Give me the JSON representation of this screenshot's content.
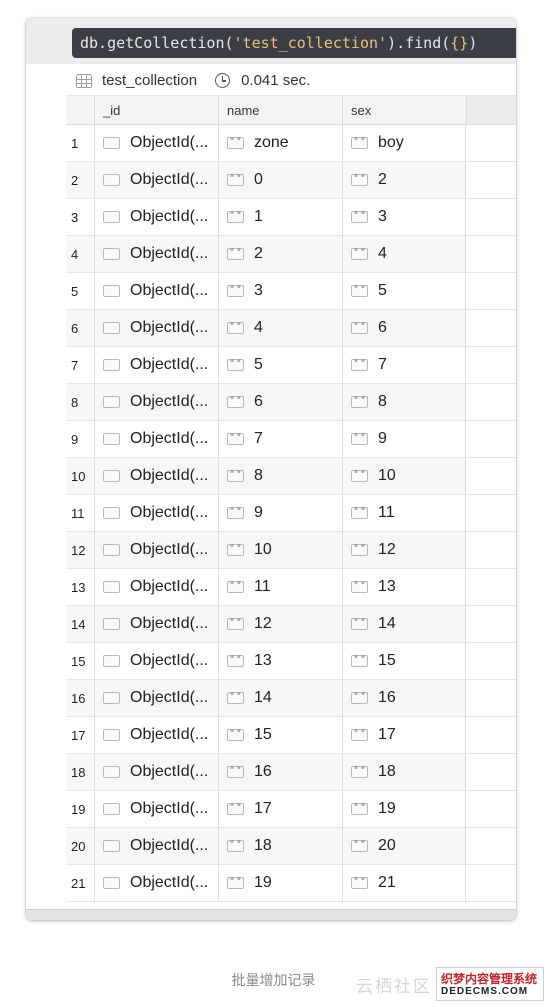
{
  "query": {
    "prefix": "db.getCollection(",
    "collection_arg": "'test_collection'",
    "suffix": ").find(",
    "braces": "{}",
    "close": ")"
  },
  "info": {
    "collection_name": "test_collection",
    "elapsed": "0.041 sec.",
    "table_icon": "table-icon",
    "clock_icon": "clock-icon"
  },
  "columns": [
    "_id",
    "name",
    "sex"
  ],
  "rows": [
    {
      "num": "1",
      "id": "ObjectId(...",
      "name": "zone",
      "sex": "boy"
    },
    {
      "num": "2",
      "id": "ObjectId(...",
      "name": "0",
      "sex": "2"
    },
    {
      "num": "3",
      "id": "ObjectId(...",
      "name": "1",
      "sex": "3"
    },
    {
      "num": "4",
      "id": "ObjectId(...",
      "name": "2",
      "sex": "4"
    },
    {
      "num": "5",
      "id": "ObjectId(...",
      "name": "3",
      "sex": "5"
    },
    {
      "num": "6",
      "id": "ObjectId(...",
      "name": "4",
      "sex": "6"
    },
    {
      "num": "7",
      "id": "ObjectId(...",
      "name": "5",
      "sex": "7"
    },
    {
      "num": "8",
      "id": "ObjectId(...",
      "name": "6",
      "sex": "8"
    },
    {
      "num": "9",
      "id": "ObjectId(...",
      "name": "7",
      "sex": "9"
    },
    {
      "num": "10",
      "id": "ObjectId(...",
      "name": "8",
      "sex": "10"
    },
    {
      "num": "11",
      "id": "ObjectId(...",
      "name": "9",
      "sex": "11"
    },
    {
      "num": "12",
      "id": "ObjectId(...",
      "name": "10",
      "sex": "12"
    },
    {
      "num": "13",
      "id": "ObjectId(...",
      "name": "11",
      "sex": "13"
    },
    {
      "num": "14",
      "id": "ObjectId(...",
      "name": "12",
      "sex": "14"
    },
    {
      "num": "15",
      "id": "ObjectId(...",
      "name": "13",
      "sex": "15"
    },
    {
      "num": "16",
      "id": "ObjectId(...",
      "name": "14",
      "sex": "16"
    },
    {
      "num": "17",
      "id": "ObjectId(...",
      "name": "15",
      "sex": "17"
    },
    {
      "num": "18",
      "id": "ObjectId(...",
      "name": "16",
      "sex": "18"
    },
    {
      "num": "19",
      "id": "ObjectId(...",
      "name": "17",
      "sex": "19"
    },
    {
      "num": "20",
      "id": "ObjectId(...",
      "name": "18",
      "sex": "20"
    },
    {
      "num": "21",
      "id": "ObjectId(...",
      "name": "19",
      "sex": "21"
    }
  ],
  "icons": {
    "objectid": "objectid-icon",
    "string": "string-icon",
    "string_glyph": "\" \""
  },
  "caption": "批量增加记录",
  "watermark": {
    "faint": "云栖社区",
    "line1": "织梦内容管理系统",
    "line2": "DEDECMS.COM"
  }
}
